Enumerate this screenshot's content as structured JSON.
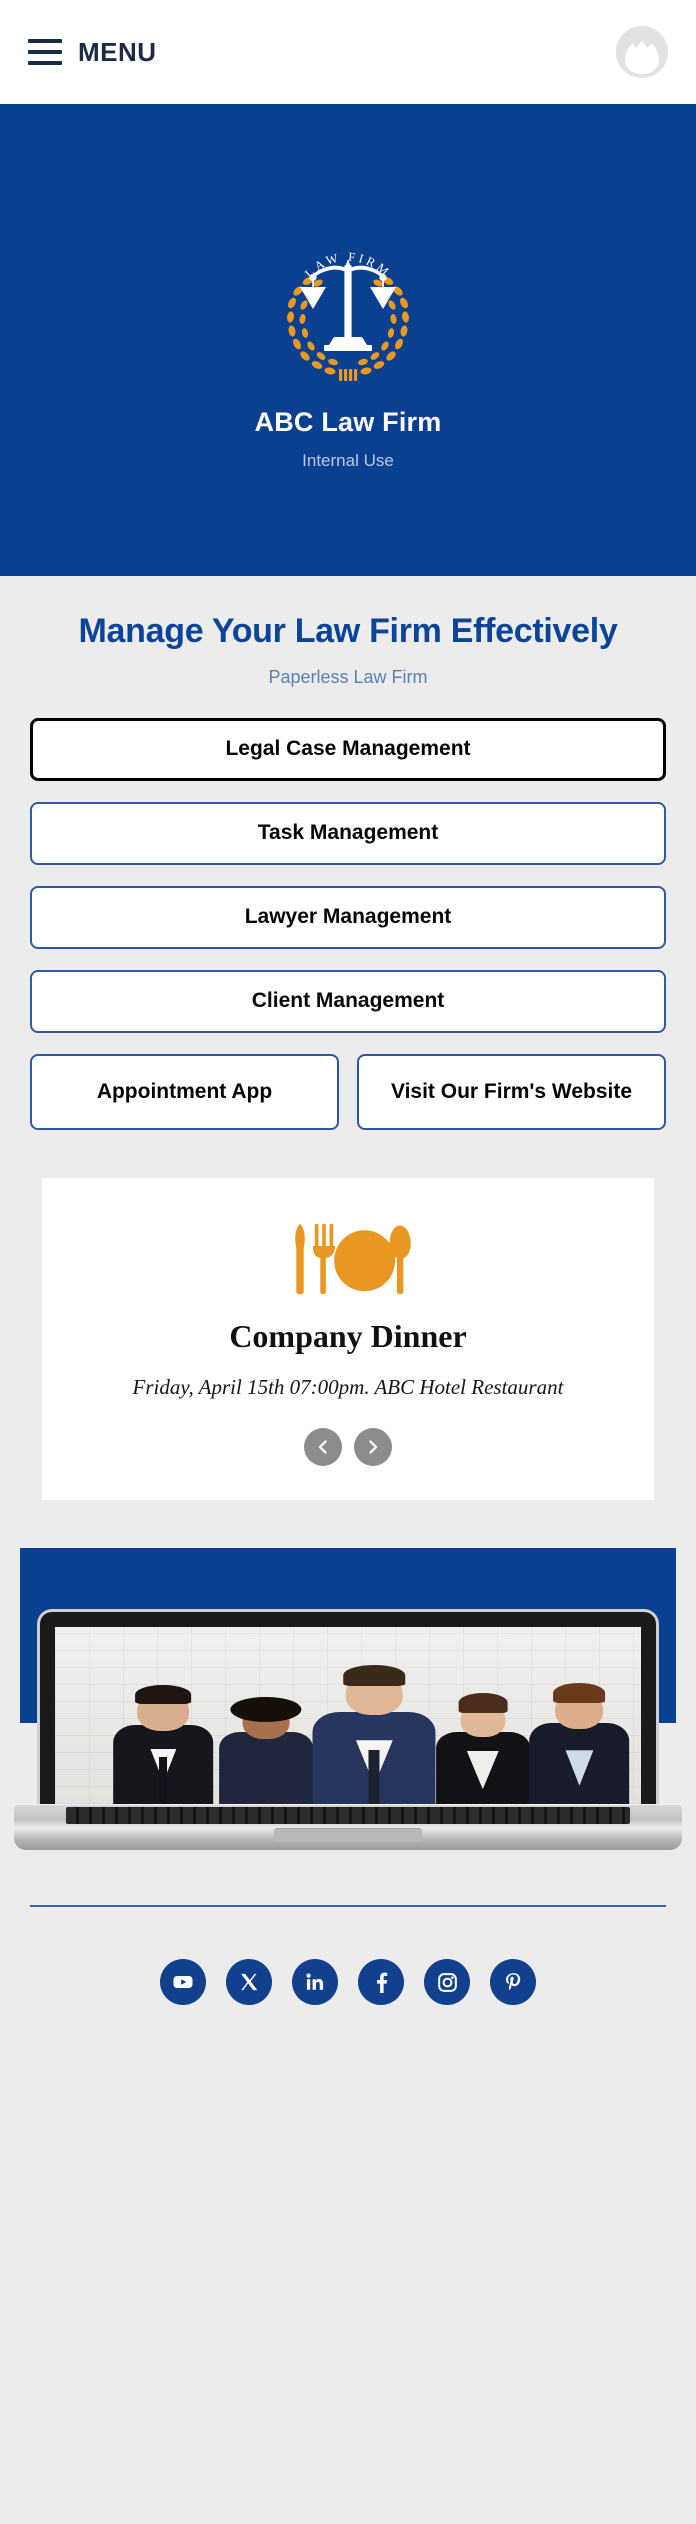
{
  "topbar": {
    "menu_label": "MENU",
    "menu_icon": "hamburger-icon",
    "avatar_icon": "user-avatar-icon"
  },
  "hero": {
    "logo_arc_text": "LAW FIRM",
    "logo_icon": "scales-of-justice-laurel-logo",
    "title": "ABC Law Firm",
    "subtitle": "Internal Use",
    "background_color": "#0b3f8f"
  },
  "section": {
    "heading": "Manage Your Law Firm Effectively",
    "subheading": "Paperless Law Firm",
    "heading_color": "#0b4499"
  },
  "buttons": {
    "stacked": [
      {
        "label": "Legal Case Management",
        "focused": true
      },
      {
        "label": "Task Management",
        "focused": false
      },
      {
        "label": "Lawyer Management",
        "focused": false
      },
      {
        "label": "Client Management",
        "focused": false
      }
    ],
    "row": [
      {
        "label": "Appointment App"
      },
      {
        "label": "Visit Our Firm's Website"
      }
    ],
    "border_color": "#2f5aa0"
  },
  "event_card": {
    "icon": "dinner-plate-cutlery-icon",
    "icon_color": "#e89722",
    "title": "Company Dinner",
    "details": "Friday, April 15th 07:00pm. ABC Hotel Restaurant",
    "prev_icon": "chevron-left-icon",
    "next_icon": "chevron-right-icon"
  },
  "showcase": {
    "image_alt": "Team of five business professionals in suits",
    "device": "laptop-mockup",
    "band_color": "#0b4090"
  },
  "footer": {
    "divider_color": "#3a62a8",
    "social_color": "#13408c",
    "socials": [
      {
        "name": "youtube-icon",
        "label": "YouTube"
      },
      {
        "name": "x-twitter-icon",
        "label": "X"
      },
      {
        "name": "linkedin-icon",
        "label": "LinkedIn"
      },
      {
        "name": "facebook-icon",
        "label": "Facebook"
      },
      {
        "name": "instagram-icon",
        "label": "Instagram"
      },
      {
        "name": "pinterest-icon",
        "label": "Pinterest"
      }
    ]
  }
}
